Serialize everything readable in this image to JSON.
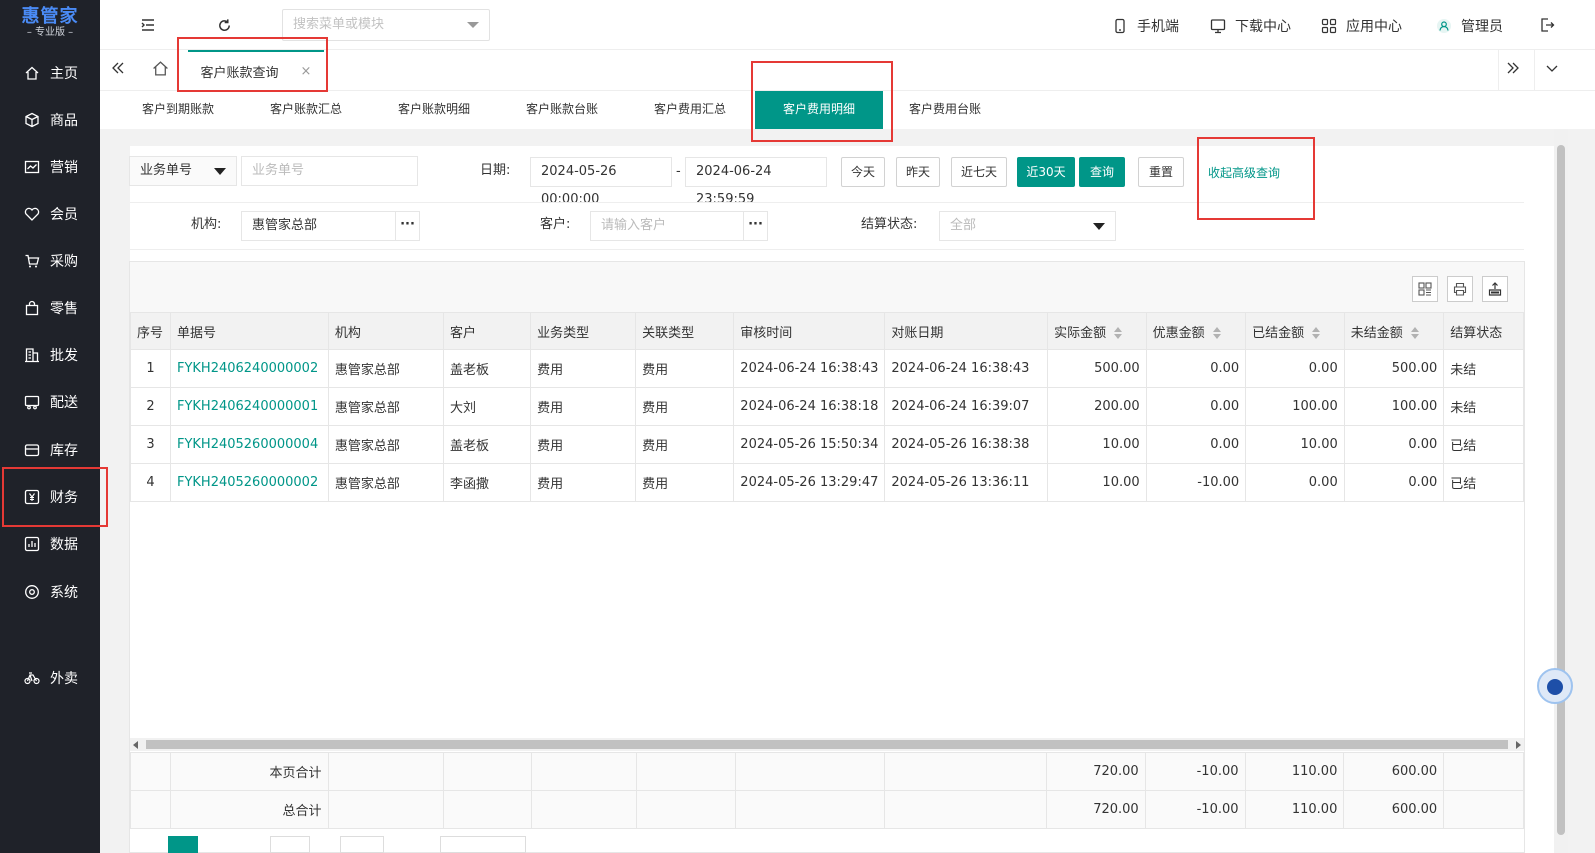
{
  "brand": {
    "logo": "惠管家",
    "edition": "专业版"
  },
  "sidebar": {
    "items": [
      {
        "label": "主页",
        "icon": "home-icon"
      },
      {
        "label": "商品",
        "icon": "box-icon"
      },
      {
        "label": "营销",
        "icon": "chart-icon"
      },
      {
        "label": "会员",
        "icon": "heart-icon"
      },
      {
        "label": "采购",
        "icon": "cart-icon"
      },
      {
        "label": "零售",
        "icon": "bag-icon"
      },
      {
        "label": "批发",
        "icon": "building-icon"
      },
      {
        "label": "配送",
        "icon": "truck-icon"
      },
      {
        "label": "库存",
        "icon": "inventory-icon"
      },
      {
        "label": "财务",
        "icon": "yuan-icon"
      },
      {
        "label": "数据",
        "icon": "data-icon"
      },
      {
        "label": "系统",
        "icon": "settings-icon"
      },
      {
        "label": "外卖",
        "icon": "bike-icon"
      }
    ]
  },
  "topbar": {
    "search_placeholder": "搜索菜单或模块",
    "mobile": "手机端",
    "download": "下载中心",
    "apps": "应用中心",
    "user": "管理员"
  },
  "tabbar": {
    "open_tab": "客户账款查询",
    "close": "×"
  },
  "subtabs": [
    "客户到期账款",
    "客户账款汇总",
    "客户账款明细",
    "客户账款台账",
    "客户费用汇总",
    "客户费用明细",
    "客户费用台账"
  ],
  "filters": {
    "doc_type_select": "业务单号",
    "doc_no_placeholder": "业务单号",
    "date_label": "日期:",
    "date_start": "2024-05-26 00:00:00",
    "date_sep": "-",
    "date_end": "2024-06-24 23:59:59",
    "btn_today": "今天",
    "btn_yesterday": "昨天",
    "btn_7days": "近七天",
    "btn_30days": "近30天",
    "btn_query": "查询",
    "btn_reset": "重置",
    "collapse_link": "收起高级查询",
    "org_label": "机构:",
    "org_value": "惠管家总部",
    "customer_label": "客户:",
    "customer_placeholder": "请输入客户",
    "settle_label": "结算状态:",
    "settle_value": "全部",
    "more": "···"
  },
  "table": {
    "headers": [
      "序号",
      "单据号",
      "机构",
      "客户",
      "业务类型",
      "关联类型",
      "审核时间",
      "对账日期",
      "实际金额",
      "优惠金额",
      "已结金额",
      "未结金额",
      "结算状态"
    ],
    "rows": [
      [
        "1",
        "FYKH2406240000002",
        "惠管家总部",
        "盖老板",
        "费用",
        "费用",
        "2024-06-24 16:38:43",
        "2024-06-24 16:38:43",
        "500.00",
        "0.00",
        "0.00",
        "500.00",
        "未结"
      ],
      [
        "2",
        "FYKH2406240000001",
        "惠管家总部",
        "大刘",
        "费用",
        "费用",
        "2024-06-24 16:38:18",
        "2024-06-24 16:39:07",
        "200.00",
        "0.00",
        "100.00",
        "100.00",
        "未结"
      ],
      [
        "3",
        "FYKH2405260000004",
        "惠管家总部",
        "盖老板",
        "费用",
        "费用",
        "2024-05-26 15:50:34",
        "2024-05-26 16:38:38",
        "10.00",
        "0.00",
        "10.00",
        "0.00",
        "已结"
      ],
      [
        "4",
        "FYKH2405260000002",
        "惠管家总部",
        "李函撒",
        "费用",
        "费用",
        "2024-05-26 13:29:47",
        "2024-05-26 13:36:11",
        "10.00",
        "-10.00",
        "0.00",
        "0.00",
        "已结"
      ]
    ],
    "page_total": {
      "label": "本页合计",
      "values": [
        "720.00",
        "-10.00",
        "110.00",
        "600.00"
      ]
    },
    "grand_total": {
      "label": "总合计",
      "values": [
        "720.00",
        "-10.00",
        "110.00",
        "600.00"
      ]
    }
  },
  "colors": {
    "accent": "#009688",
    "sidebar_bg": "#1f2229",
    "highlight": "#e53935"
  }
}
